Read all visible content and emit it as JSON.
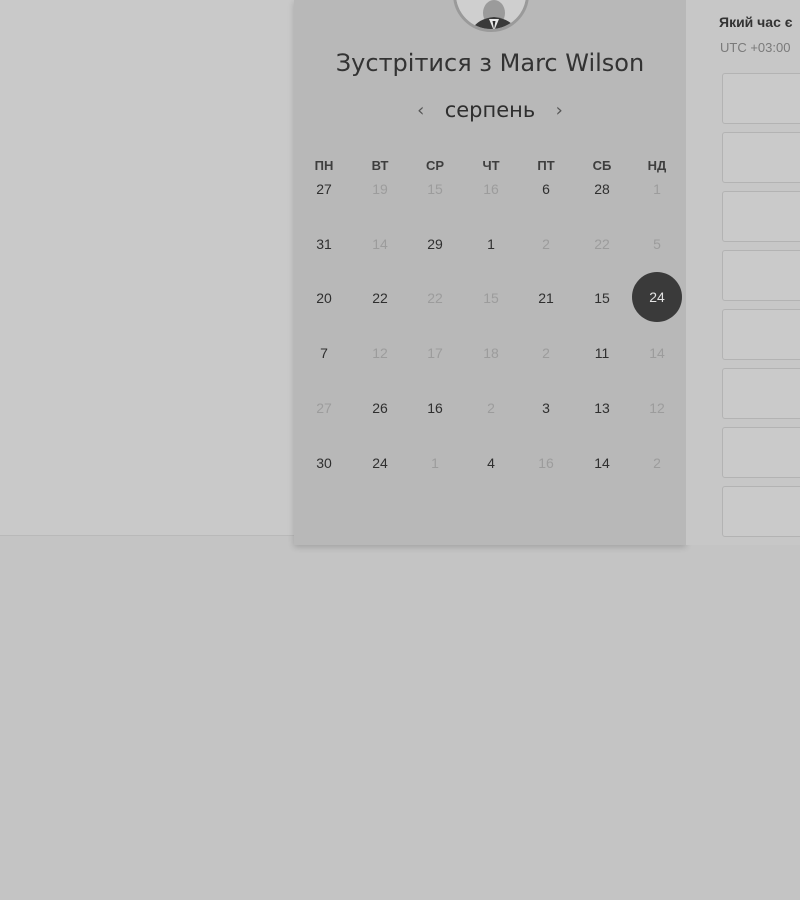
{
  "colors": {
    "page_bg": "#c4c4c4",
    "calendar_panel_bg": "#b8b8b8",
    "selected_day_bg": "#3a3a3a",
    "text_primary": "#2f2f2f",
    "text_disabled": "#9c9c9c"
  },
  "calendar": {
    "title": "Зустрітися з Marc Wilson",
    "month": "серпень",
    "prev_icon": "chevron-left-icon",
    "next_icon": "chevron-right-icon",
    "weekdays": [
      "ПН",
      "ВТ",
      "СР",
      "ЧТ",
      "ПТ",
      "СБ",
      "НД"
    ],
    "weeks": [
      [
        {
          "d": "27",
          "on": true
        },
        {
          "d": "19",
          "on": false
        },
        {
          "d": "15",
          "on": false
        },
        {
          "d": "16",
          "on": false
        },
        {
          "d": "6",
          "on": true
        },
        {
          "d": "28",
          "on": true
        },
        {
          "d": "1",
          "on": false
        }
      ],
      [
        {
          "d": "31",
          "on": true
        },
        {
          "d": "14",
          "on": false
        },
        {
          "d": "29",
          "on": true
        },
        {
          "d": "1",
          "on": true
        },
        {
          "d": "2",
          "on": false
        },
        {
          "d": "22",
          "on": false
        },
        {
          "d": "5",
          "on": false
        }
      ],
      [
        {
          "d": "20",
          "on": true
        },
        {
          "d": "22",
          "on": true
        },
        {
          "d": "22",
          "on": false
        },
        {
          "d": "15",
          "on": false
        },
        {
          "d": "21",
          "on": true
        },
        {
          "d": "15",
          "on": true
        },
        {
          "d": "24",
          "on": true,
          "selected": true
        }
      ],
      [
        {
          "d": "7",
          "on": true
        },
        {
          "d": "12",
          "on": false
        },
        {
          "d": "17",
          "on": false
        },
        {
          "d": "18",
          "on": false
        },
        {
          "d": "2",
          "on": false
        },
        {
          "d": "11",
          "on": true
        },
        {
          "d": "14",
          "on": false
        }
      ],
      [
        {
          "d": "27",
          "on": false
        },
        {
          "d": "26",
          "on": true
        },
        {
          "d": "16",
          "on": true
        },
        {
          "d": "2",
          "on": false
        },
        {
          "d": "3",
          "on": true
        },
        {
          "d": "13",
          "on": true
        },
        {
          "d": "12",
          "on": false
        }
      ],
      [
        {
          "d": "30",
          "on": true
        },
        {
          "d": "24",
          "on": true
        },
        {
          "d": "1",
          "on": false
        },
        {
          "d": "4",
          "on": true
        },
        {
          "d": "16",
          "on": false
        },
        {
          "d": "14",
          "on": true
        },
        {
          "d": "2",
          "on": false
        }
      ]
    ]
  },
  "time_panel": {
    "title": "Який час є",
    "timezone": "UTC +03:00",
    "slot_count": 8
  }
}
